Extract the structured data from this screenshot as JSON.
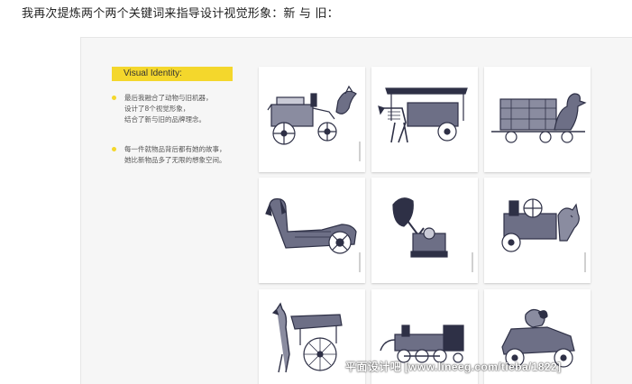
{
  "intro": "我再次提炼两个两个关键词来指导设计视觉形象：新 与 旧：",
  "colors": {
    "accent": "#f4d72c",
    "panel_bg": "#f6f6f6",
    "ink": "#2e3046"
  },
  "sidebar": {
    "title": "Visual Identity:",
    "bullets": [
      {
        "lines": [
          "最后我融合了动物与旧机器，",
          "设计了8个视觉形象，",
          "结合了新与旧的品牌理念。"
        ]
      },
      {
        "lines": [
          "每一件就物品背后都有她的故事，",
          "她比新物品多了无限的想象空间。"
        ]
      }
    ]
  },
  "cards": [
    {
      "icon": "horse-cart-with-rooster-illustration"
    },
    {
      "icon": "zebra-carriage-car-illustration"
    },
    {
      "icon": "duck-rail-wagon-illustration"
    },
    {
      "icon": "dachshund-car-illustration"
    },
    {
      "icon": "gramophone-illustration"
    },
    {
      "icon": "cat-steam-engine-illustration"
    },
    {
      "icon": "alpaca-carriage-illustration"
    },
    {
      "icon": "steam-locomotive-illustration"
    },
    {
      "icon": "ram-vintage-car-illustration"
    }
  ],
  "watermark": "平面设计吧 [www.lineeg.com/tieba/1822]"
}
